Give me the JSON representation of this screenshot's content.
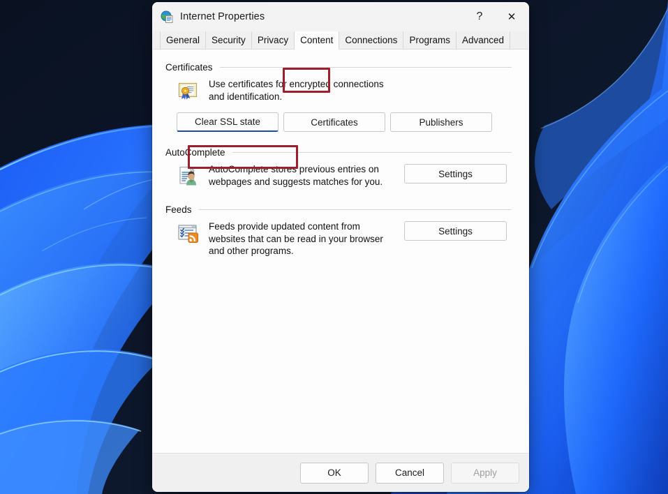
{
  "desktop": {
    "name": "windows-11-bloom-wallpaper",
    "background_color": "#0b1526",
    "accent_blue": "#1f6bff"
  },
  "dialog": {
    "title": "Internet Properties",
    "icon": "internet-properties-icon",
    "caption_buttons": {
      "help": "?",
      "close": "✕"
    },
    "tabs": [
      {
        "label": "General",
        "active": false
      },
      {
        "label": "Security",
        "active": false
      },
      {
        "label": "Privacy",
        "active": false
      },
      {
        "label": "Content",
        "active": true
      },
      {
        "label": "Connections",
        "active": false
      },
      {
        "label": "Programs",
        "active": false
      },
      {
        "label": "Advanced",
        "active": false
      }
    ],
    "groups": [
      {
        "title": "Certificates",
        "icon": "certificate-icon",
        "description": "Use certificates for encrypted connections and identification.",
        "buttons": [
          {
            "label": "Clear SSL state",
            "highlighted": true,
            "disabled": false
          },
          {
            "label": "Certificates",
            "highlighted": false,
            "disabled": false
          },
          {
            "label": "Publishers",
            "highlighted": false,
            "disabled": false
          }
        ]
      },
      {
        "title": "AutoComplete",
        "icon": "autocomplete-icon",
        "description": "AutoComplete stores previous entries on webpages and suggests matches for you.",
        "button": {
          "label": "Settings",
          "disabled": false
        }
      },
      {
        "title": "Feeds",
        "icon": "feeds-icon",
        "description": "Feeds provide updated content from websites that can be read in your browser and other programs.",
        "button": {
          "label": "Settings",
          "disabled": false
        }
      }
    ],
    "footer": {
      "ok": "OK",
      "cancel": "Cancel",
      "apply": "Apply"
    }
  },
  "annotations": {
    "color": "#9c1f2e",
    "boxes": [
      {
        "target": "tab-content",
        "label": "Content"
      },
      {
        "target": "clear-ssl-state-button",
        "label": "Clear SSL state"
      }
    ]
  }
}
